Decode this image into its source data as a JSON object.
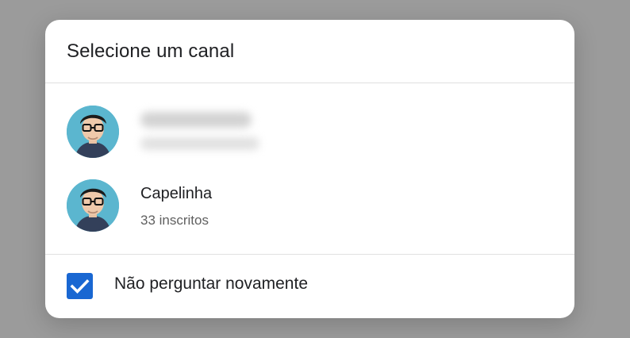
{
  "dialog": {
    "title": "Selecione um canal"
  },
  "channels": [
    {
      "name": "",
      "subtitle": "",
      "redacted": true
    },
    {
      "name": "Capelinha",
      "subtitle": "33 inscritos",
      "redacted": false
    }
  ],
  "footer": {
    "checkbox_label": "Não perguntar novamente",
    "checkbox_checked": true
  },
  "colors": {
    "backdrop": "#9b9b9b",
    "dialog_bg": "#ffffff",
    "checkbox_blue": "#1967d2",
    "avatar_bg": "#5bb6cf"
  },
  "icons": {
    "avatar": "person-avatar-icon",
    "checkbox": "check-icon"
  }
}
